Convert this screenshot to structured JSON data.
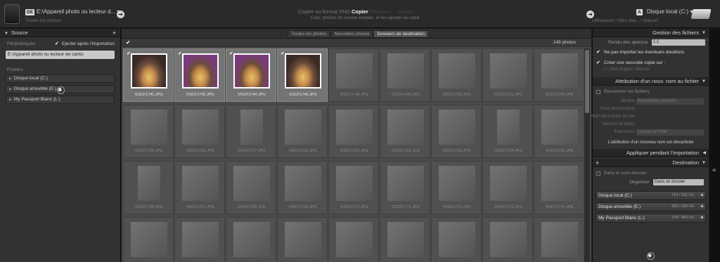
{
  "topbar": {
    "source_badge": "DE",
    "source_title": "E:\\Appareil photo ou lecteur d... ▾",
    "source_sub": "Toutes les photos",
    "modes": [
      "Copier au format DNG",
      "Copier",
      "Déplacer",
      "Ajouter"
    ],
    "mode_desc_line1": "Copi. photos du nouvel emplac. et les ajouter au catal.",
    "dest_badge": "A",
    "dest_title": "Disque local (C:) ▾",
    "dest_sub": "Utilisateurs \\ Mes ima... \\ Maison"
  },
  "left": {
    "header": "Source",
    "peripherals_label": "Périphériques",
    "eject_label": "Ejecter après l'importation",
    "path_value": "E:\\Appareil photo ou lecteur de carte)",
    "files_label": "Fichiers",
    "drives": [
      "Disque local (C:)",
      "Disque amovible (E:)",
      "My Passport Blanc (L:)"
    ]
  },
  "center": {
    "filter_tabs": [
      "Toutes les photos",
      "Nouvelles photos",
      "Dossiers de destination"
    ],
    "photo_count": "149 photos",
    "photos": [
      [
        "DSCF1741.JPG",
        "DSCF1742.JPG",
        "DSCF1744.JPG",
        "DSCF1746.JPG",
        "DSCF1748.JPG",
        "DSCF1749.JPG",
        "DSCF1750.JPG",
        "DSCF1751.JPG",
        "DSCF1754.JPG"
      ],
      [
        "DSCF1755.JPG",
        "DSCF1756.JPG",
        "DSCF1757.JPG",
        "DSCF1759.JPG",
        "DSCF1760.JPG",
        "DSCF1762.JPG",
        "DSCF1763.JPG",
        "DSCF1764.JPG",
        "DSCF1765.JPG"
      ],
      [
        "DSCF1766.JPG",
        "DSCF1767.JPG",
        "DSCF1768.JPG",
        "DSCF1769.JPG",
        "DSCF1770.JPG",
        "DSCF1771.JPG",
        "DSCF1772.JPG",
        "DSCF1773.JPG",
        "DSCF1774.JPG"
      ],
      [
        "",
        "",
        "",
        "",
        "",
        "",
        "",
        "",
        ""
      ]
    ]
  },
  "right": {
    "mgmt_header": "Gestion des fichiers",
    "preview_label": "Rendu des aperçus",
    "preview_value": "1:1",
    "no_duplicates": "Ne pas importer les éventuels doublons",
    "second_copy": "Créer une seconde copie sur :",
    "second_copy_path": "L:\\ Mes images \\ Maison",
    "rename_header": "Attribution d'un nouv. nom au fichier",
    "rename_label": "Renommer les fichiers",
    "model_label": "Modèle",
    "model_value": "Paramètres personn...",
    "custom_text_label": "Texte personnalisé",
    "shoot_name_label": "Nom de la prise de vue",
    "start_number_label": "Numéro de début",
    "extensions_label": "Extensions",
    "extensions_value": "Laisser en l'état",
    "rename_disabled": "L'attribution d'un nouveau nom est désactivée",
    "apply_header": "Appliquer pendant l'importation",
    "dest_header": "Destination",
    "subfolder_label": "Dans le sous-dossier",
    "organize_label": "Organiser",
    "organize_value": "Dans un dossier",
    "drives": [
      {
        "name": "Disque local (C:)",
        "free": "714 / 931 Go"
      },
      {
        "name": "Disque amovible (E:)",
        "free": "583 / 930 Go"
      },
      {
        "name": "My Passport Blanc (L:)",
        "free": "278 / 465 Go"
      }
    ]
  }
}
